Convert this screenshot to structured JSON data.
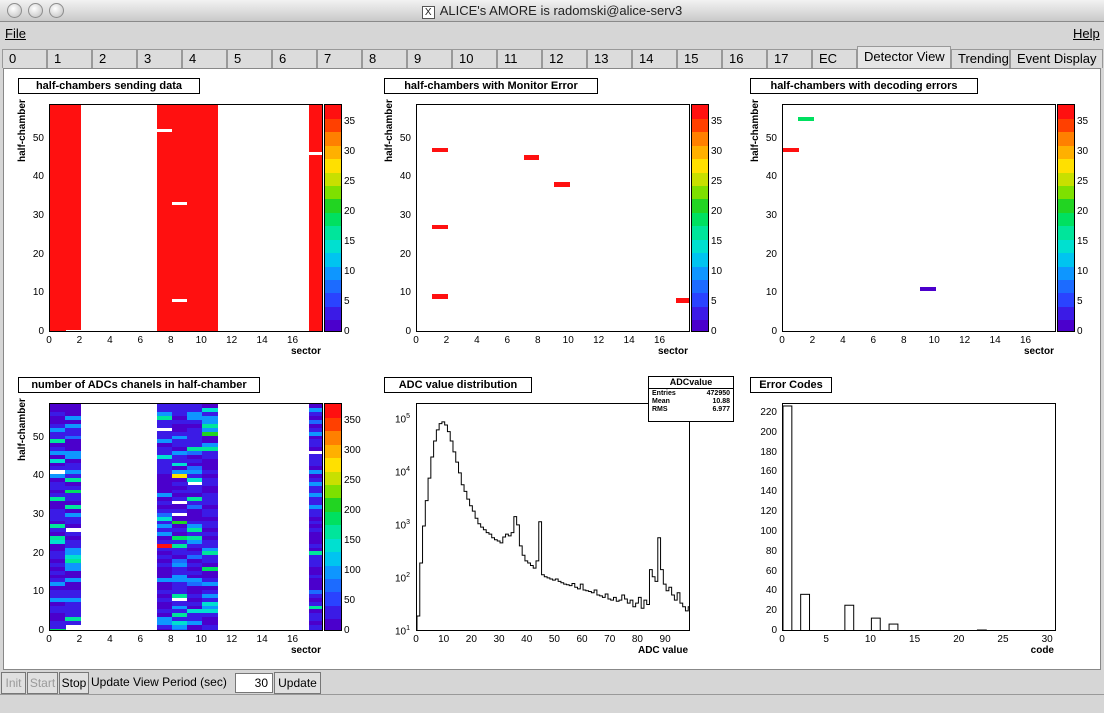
{
  "window": {
    "title": "ALICE's AMORE is radomski@alice-serv3",
    "x_icon": "X"
  },
  "menubar": {
    "file": "File",
    "help": "Help"
  },
  "tabs": [
    "0",
    "1",
    "2",
    "3",
    "4",
    "5",
    "6",
    "7",
    "8",
    "9",
    "10",
    "11",
    "12",
    "13",
    "14",
    "15",
    "16",
    "17",
    "EC",
    "Detector View",
    "Trending",
    "Event Display"
  ],
  "active_tab": "Detector View",
  "panels": {
    "p1": {
      "title": "half-chambers sending data",
      "ylabel": "half-chamber",
      "xlabel": "sector"
    },
    "p2": {
      "title": "half-chambers with Monitor Error",
      "ylabel": "half-chamber",
      "xlabel": "sector"
    },
    "p3": {
      "title": "half-chambers with decoding errors",
      "ylabel": "half-chamber",
      "xlabel": "sector"
    },
    "p4": {
      "title": "number of ADCs chanels in half-chamber",
      "ylabel": "half-chamber",
      "xlabel": "sector"
    },
    "p5": {
      "title": "ADC value distribution",
      "xlabel": "ADC value"
    },
    "p6": {
      "title": "Error Codes",
      "xlabel": "code"
    }
  },
  "stats": {
    "name": "ADCvalue",
    "entries_label": "Entries",
    "entries": "472950",
    "mean_label": "Mean",
    "mean": "10.88",
    "rms_label": "RMS",
    "rms": "6.977"
  },
  "bottombar": {
    "init": "Init",
    "start": "Start",
    "stop": "Stop",
    "period_label": "Update View Period (sec)",
    "period_value": "30",
    "update": "Update"
  },
  "colors": {
    "palette": [
      "#4b00cc",
      "#3b1be6",
      "#2a43ff",
      "#1c6bff",
      "#0e96ff",
      "#00c4f0",
      "#00e0d0",
      "#00e59b",
      "#00e060",
      "#22d422",
      "#7ee000",
      "#c8e000",
      "#ffe000",
      "#ffb000",
      "#ff8000",
      "#ff4000",
      "#ff1010"
    ],
    "red": "#ff1a1a"
  },
  "chart_data": [
    {
      "id": "p1",
      "type": "heatmap",
      "title": "half-chambers sending data",
      "xlabel": "sector",
      "ylabel": "half-chamber",
      "xlim": [
        0,
        18
      ],
      "ylim": [
        0,
        59
      ],
      "xticks": [
        0,
        2,
        4,
        6,
        8,
        10,
        12,
        14,
        16
      ],
      "yticks": [
        0,
        10,
        20,
        30,
        40,
        50
      ],
      "zticks": [
        0,
        5,
        10,
        15,
        20,
        25,
        30,
        35
      ],
      "zlim": [
        0,
        38
      ],
      "filled_sectors": [
        0,
        1,
        7,
        8,
        9,
        10,
        17
      ],
      "fill_value": 37,
      "empty_cells": [
        [
          1,
          0
        ],
        [
          7,
          52
        ],
        [
          8,
          33
        ],
        [
          8,
          8
        ],
        [
          17,
          46
        ]
      ]
    },
    {
      "id": "p2",
      "type": "heatmap",
      "title": "half-chambers with Monitor Error",
      "xlabel": "sector",
      "ylabel": "half-chamber",
      "xlim": [
        0,
        18
      ],
      "ylim": [
        0,
        59
      ],
      "xticks": [
        0,
        2,
        4,
        6,
        8,
        10,
        12,
        14,
        16
      ],
      "yticks": [
        0,
        10,
        20,
        30,
        40,
        50
      ],
      "zticks": [
        0,
        5,
        10,
        15,
        20,
        25,
        30,
        35
      ],
      "zlim": [
        0,
        38
      ],
      "cells": [
        {
          "x": 1,
          "y": 47,
          "z": 37
        },
        {
          "x": 1,
          "y": 27,
          "z": 37
        },
        {
          "x": 1,
          "y": 9,
          "z": 37
        },
        {
          "x": 7,
          "y": 45,
          "z": 37
        },
        {
          "x": 9,
          "y": 38,
          "z": 37
        },
        {
          "x": 17,
          "y": 8,
          "z": 37
        }
      ]
    },
    {
      "id": "p3",
      "type": "heatmap",
      "title": "half-chambers with decoding errors",
      "xlabel": "sector",
      "ylabel": "half-chamber",
      "xlim": [
        0,
        18
      ],
      "ylim": [
        0,
        59
      ],
      "xticks": [
        0,
        2,
        4,
        6,
        8,
        10,
        12,
        14,
        16
      ],
      "yticks": [
        0,
        10,
        20,
        30,
        40,
        50
      ],
      "zticks": [
        0,
        5,
        10,
        15,
        20,
        25,
        30,
        35
      ],
      "zlim": [
        0,
        38
      ],
      "cells": [
        {
          "x": 0,
          "y": 47,
          "z": 37
        },
        {
          "x": 1,
          "y": 55,
          "z": 18
        },
        {
          "x": 9,
          "y": 11,
          "z": 2
        }
      ]
    },
    {
      "id": "p4",
      "type": "heatmap",
      "title": "number of ADCs chanels in half-chamber",
      "xlabel": "sector",
      "ylabel": "half-chamber",
      "xlim": [
        0,
        18
      ],
      "ylim": [
        0,
        59
      ],
      "xticks": [
        0,
        2,
        4,
        6,
        8,
        10,
        12,
        14,
        16
      ],
      "yticks": [
        0,
        10,
        20,
        30,
        40,
        50
      ],
      "zticks": [
        0,
        50,
        100,
        150,
        200,
        250,
        300,
        350
      ],
      "zlim": [
        0,
        380
      ],
      "sectors": [
        0,
        1,
        7,
        8,
        9,
        10,
        17
      ],
      "typical_value": 40,
      "special_cells": [
        {
          "x": 7,
          "y": 22,
          "z": 380
        },
        {
          "x": 8,
          "y": 40,
          "z": 270
        },
        {
          "x": 0,
          "y": 0,
          "z": 200
        },
        {
          "x": 1,
          "y": 0,
          "z": 180
        },
        {
          "x": 10,
          "y": 51,
          "z": 210
        },
        {
          "x": 8,
          "y": 24,
          "z": 200
        },
        {
          "x": 0,
          "y": 49,
          "z": 160
        },
        {
          "x": 1,
          "y": 36,
          "z": 180
        },
        {
          "x": 8,
          "y": 28,
          "z": 220
        },
        {
          "x": 10,
          "y": 16,
          "z": 180
        }
      ],
      "empty_cells": [
        [
          1,
          0
        ],
        [
          1,
          1
        ],
        [
          7,
          52
        ],
        [
          8,
          33
        ],
        [
          8,
          8
        ],
        [
          17,
          46
        ],
        [
          0,
          41
        ],
        [
          1,
          26
        ],
        [
          8,
          30
        ],
        [
          9,
          38
        ]
      ]
    },
    {
      "id": "p5",
      "type": "line",
      "title": "ADC value distribution",
      "xlabel": "ADC value",
      "xlim": [
        0,
        99
      ],
      "ylog": true,
      "ylim_exp": [
        1,
        5.3
      ],
      "xticks": [
        0,
        10,
        20,
        30,
        40,
        50,
        60,
        70,
        80,
        90
      ],
      "yticks_exp": [
        1,
        2,
        3,
        4,
        5
      ],
      "x": [
        0,
        1,
        2,
        3,
        4,
        5,
        6,
        7,
        8,
        9,
        10,
        11,
        12,
        13,
        14,
        15,
        16,
        17,
        18,
        19,
        20,
        21,
        22,
        23,
        24,
        25,
        26,
        27,
        28,
        29,
        30,
        31,
        32,
        33,
        34,
        35,
        36,
        37,
        38,
        39,
        40,
        41,
        42,
        43,
        44,
        45,
        46,
        47,
        48,
        49,
        50,
        51,
        52,
        53,
        54,
        55,
        56,
        57,
        58,
        59,
        60,
        61,
        62,
        63,
        64,
        65,
        66,
        67,
        68,
        69,
        70,
        71,
        72,
        73,
        74,
        75,
        76,
        77,
        78,
        79,
        80,
        81,
        82,
        83,
        84,
        85,
        86,
        87,
        88,
        89,
        90,
        91,
        92,
        93,
        94,
        95,
        96,
        97,
        98
      ],
      "values": [
        20,
        200,
        1000,
        3000,
        8000,
        20000,
        40000,
        65000,
        85000,
        92000,
        80000,
        60000,
        40000,
        25000,
        16000,
        10000,
        6000,
        4500,
        3200,
        2400,
        1900,
        1400,
        1100,
        950,
        850,
        750,
        700,
        600,
        550,
        520,
        480,
        620,
        700,
        650,
        750,
        1500,
        1050,
        420,
        280,
        220,
        200,
        180,
        160,
        220,
        1200,
        120,
        110,
        105,
        100,
        95,
        100,
        90,
        85,
        80,
        78,
        75,
        82,
        70,
        65,
        80,
        62,
        60,
        58,
        55,
        62,
        50,
        48,
        45,
        52,
        42,
        40,
        45,
        38,
        40,
        50,
        42,
        35,
        40,
        30,
        35,
        45,
        28,
        40,
        33,
        150,
        110,
        90,
        600,
        150,
        80,
        60,
        70,
        50,
        40,
        55,
        35,
        30,
        25,
        30
      ]
    },
    {
      "id": "p6",
      "type": "bar",
      "title": "Error Codes",
      "xlabel": "code",
      "xlim": [
        0,
        31
      ],
      "ylim": [
        0,
        230
      ],
      "xticks": [
        0,
        5,
        10,
        15,
        20,
        25,
        30
      ],
      "yticks": [
        0,
        20,
        40,
        60,
        80,
        100,
        120,
        140,
        160,
        180,
        200,
        220
      ],
      "x": [
        0,
        1,
        2,
        3,
        4,
        5,
        6,
        7,
        8,
        9,
        10,
        11,
        12,
        13,
        14,
        15,
        16,
        17,
        18,
        19,
        20,
        21,
        22,
        23,
        24,
        25,
        26,
        27,
        28,
        29,
        30
      ],
      "values": [
        228,
        0,
        38,
        0,
        0,
        0,
        0,
        27,
        0,
        0,
        14,
        0,
        8,
        0,
        0,
        0,
        0,
        0,
        0,
        0,
        0,
        0,
        2,
        0,
        0,
        0,
        0,
        0,
        0,
        0,
        0
      ]
    }
  ]
}
